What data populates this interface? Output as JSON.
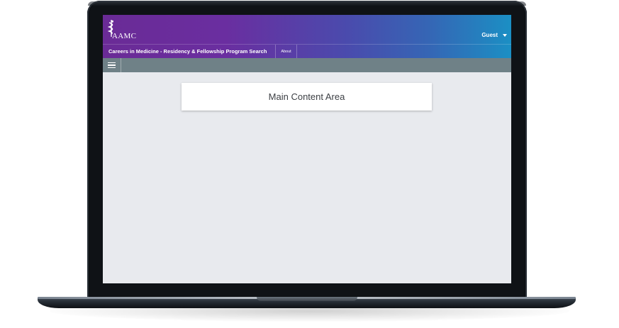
{
  "header": {
    "logo_text": "AAMC",
    "user_label": "Guest"
  },
  "subbar": {
    "app_title": "Careers in Medicine - Residency & Fellowship Program Search",
    "about_label": "About"
  },
  "main": {
    "content_label": "Main Content Area"
  },
  "colors": {
    "header_gradient_start": "#6a2b96",
    "header_gradient_end": "#1b8fc4",
    "toolbar": "#6f8187",
    "background": "#e8eaee"
  },
  "icons": {
    "menu": "hamburger-menu-icon",
    "user_caret": "caret-down-icon",
    "logo": "aamc-caduceus-logo"
  }
}
